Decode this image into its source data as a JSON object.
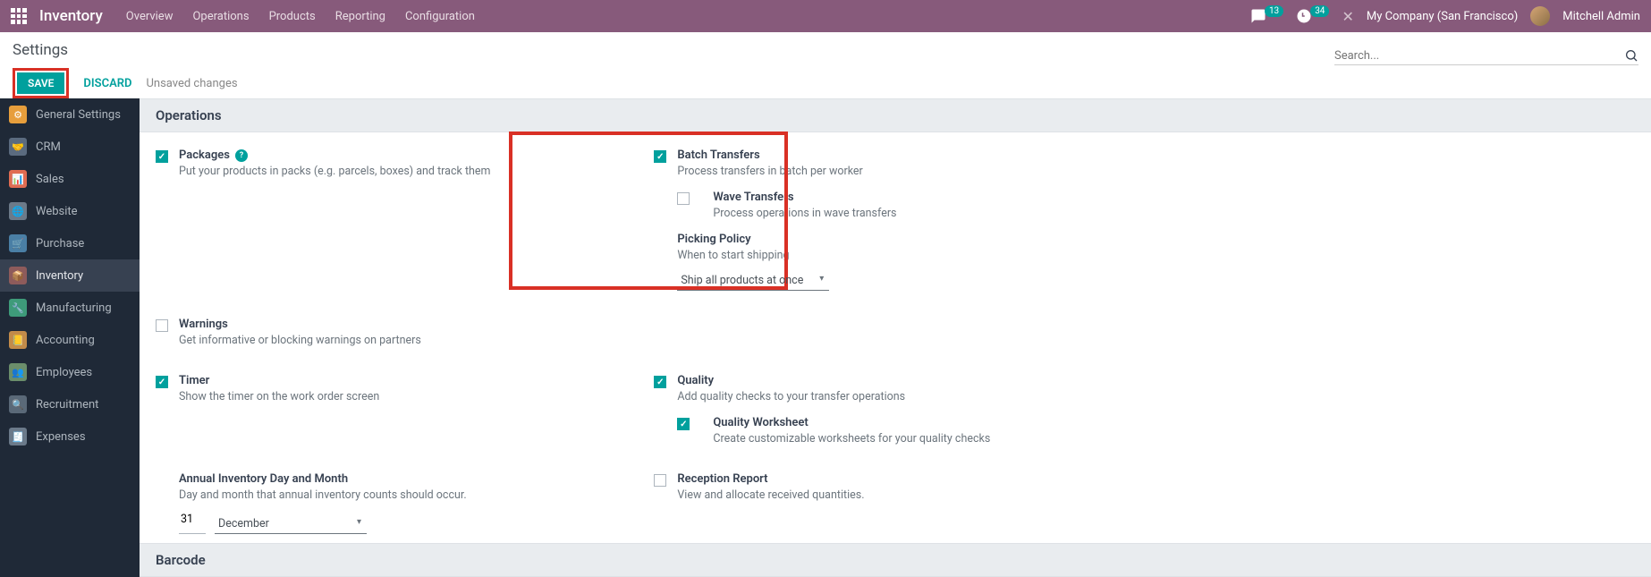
{
  "topbar": {
    "brand": "Inventory",
    "menu": [
      "Overview",
      "Operations",
      "Products",
      "Reporting",
      "Configuration"
    ],
    "chat_count": "13",
    "activity_count": "34",
    "company": "My Company (San Francisco)",
    "user": "Mitchell Admin"
  },
  "controls": {
    "title": "Settings",
    "save": "SAVE",
    "discard": "DISCARD",
    "unsaved": "Unsaved changes",
    "search_placeholder": "Search..."
  },
  "sidebar": [
    {
      "label": "General Settings"
    },
    {
      "label": "CRM"
    },
    {
      "label": "Sales"
    },
    {
      "label": "Website"
    },
    {
      "label": "Purchase"
    },
    {
      "label": "Inventory"
    },
    {
      "label": "Manufacturing"
    },
    {
      "label": "Accounting"
    },
    {
      "label": "Employees"
    },
    {
      "label": "Recruitment"
    },
    {
      "label": "Expenses"
    }
  ],
  "sections": {
    "operations": "Operations",
    "barcode": "Barcode",
    "packages": {
      "label": "Packages",
      "desc": "Put your products in packs (e.g. parcels, boxes) and track them"
    },
    "batch": {
      "label": "Batch Transfers",
      "desc": "Process transfers in batch per worker"
    },
    "wave": {
      "label": "Wave Transfers",
      "desc": "Process operations in wave transfers"
    },
    "picking": {
      "label": "Picking Policy",
      "desc": "When to start shipping",
      "value": "Ship all products at once"
    },
    "warnings": {
      "label": "Warnings",
      "desc": "Get informative or blocking warnings on partners"
    },
    "timer": {
      "label": "Timer",
      "desc": "Show the timer on the work order screen"
    },
    "quality": {
      "label": "Quality",
      "desc": "Add quality checks to your transfer operations"
    },
    "worksheet": {
      "label": "Quality Worksheet",
      "desc": "Create customizable worksheets for your quality checks"
    },
    "annual": {
      "label": "Annual Inventory Day and Month",
      "desc": "Day and month that annual inventory counts should occur.",
      "day": "31",
      "month": "December"
    },
    "reception": {
      "label": "Reception Report",
      "desc": "View and allocate received quantities."
    }
  }
}
